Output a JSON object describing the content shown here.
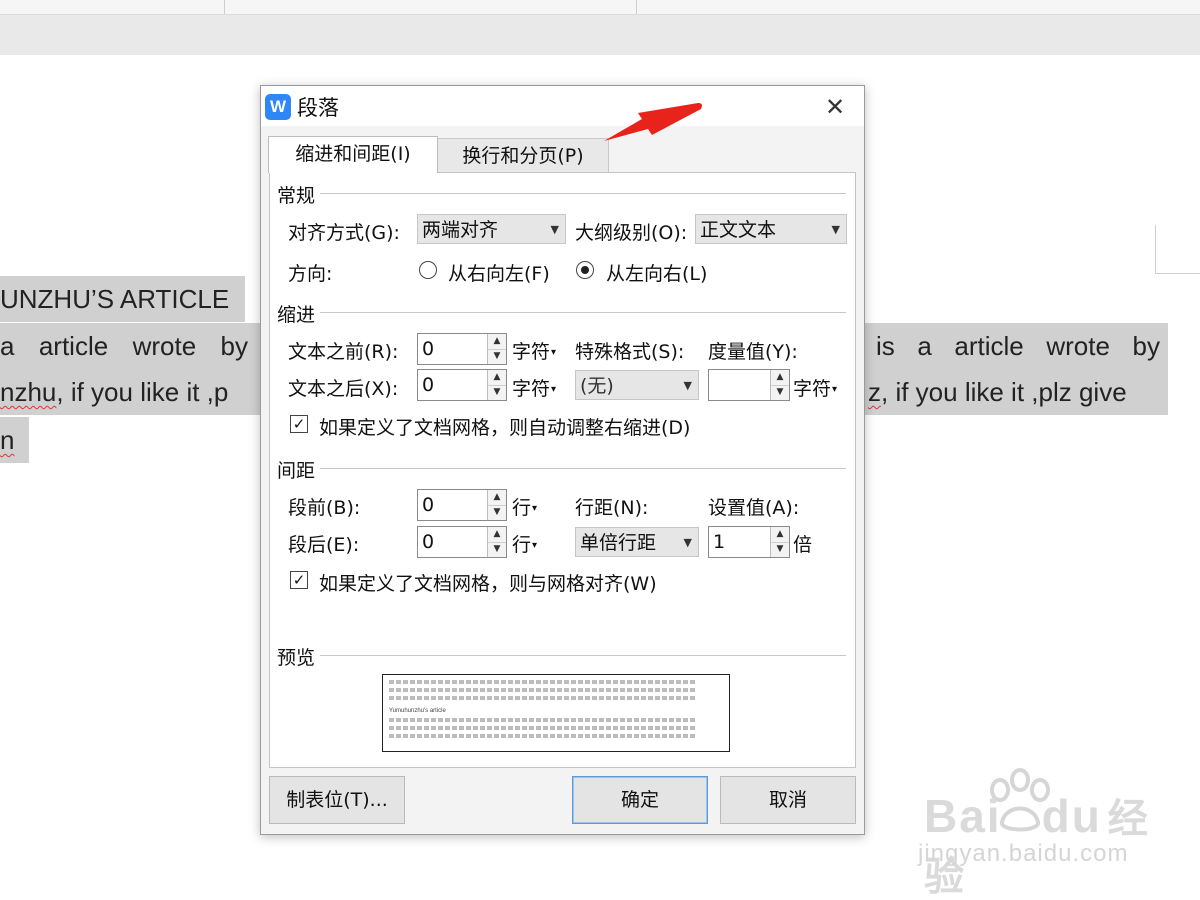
{
  "document": {
    "heading": "UNZHU’S ARTICLE",
    "left_col": {
      "line1": [
        "a",
        "article",
        "wrote",
        "by"
      ],
      "line2_prefix": "",
      "line2_squiggle": "nzhu",
      "line2_rest": ", if you like it ,p",
      "line3": "n"
    },
    "right_col": {
      "line1": [
        "is",
        "a",
        "article",
        "wrote",
        "by"
      ],
      "line2_squiggle": "z",
      "line2_rest": ", if you like it ,plz give"
    }
  },
  "watermark": {
    "brand": "Bai",
    "brand_mid": "du",
    "brand_cn": "经验",
    "url": "jingyan.baidu.com"
  },
  "dialog": {
    "icon_letter": "W",
    "title": "段落",
    "close_glyph": "✕",
    "tabs": [
      {
        "label": "缩进和间距(I)",
        "active": true
      },
      {
        "label": "换行和分页(P)",
        "active": false
      }
    ],
    "general": {
      "title": "常规",
      "align_label": "对齐方式(G):",
      "align_value": "两端对齐",
      "outline_label": "大纲级别(O):",
      "outline_value": "正文文本",
      "direction_label": "方向:",
      "rtl_label": "从右向左(F)",
      "ltr_label": "从左向右(L)",
      "direction_selected": "ltr"
    },
    "indent": {
      "title": "缩进",
      "before_label": "文本之前(R):",
      "before_value": "0",
      "before_unit": "字符",
      "after_label": "文本之后(X):",
      "after_value": "0",
      "after_unit": "字符",
      "special_label": "特殊格式(S):",
      "special_value": "(无)",
      "measure_label": "度量值(Y):",
      "measure_value": "",
      "measure_unit": "字符",
      "auto_adjust_label": "如果定义了文档网格，则自动调整右缩进(D)",
      "auto_adjust_checked": true
    },
    "spacing": {
      "title": "间距",
      "before_label": "段前(B):",
      "before_value": "0",
      "before_unit": "行",
      "after_label": "段后(E):",
      "after_value": "0",
      "after_unit": "行",
      "line_label": "行距(N):",
      "line_value": "单倍行距",
      "setting_label": "设置值(A):",
      "setting_value": "1",
      "setting_unit": "倍",
      "snap_label": "如果定义了文档网格，则与网格对齐(W)",
      "snap_checked": true
    },
    "preview": {
      "title": "预览",
      "sample_text": "Yumuhunzhu's article"
    },
    "buttons": {
      "tabs_label": "制表位(T)...",
      "ok_label": "确定",
      "cancel_label": "取消"
    }
  },
  "colors": {
    "accent": "#2f86f6",
    "arrow": "#e8231b",
    "highlight": "#d0d0d0"
  }
}
